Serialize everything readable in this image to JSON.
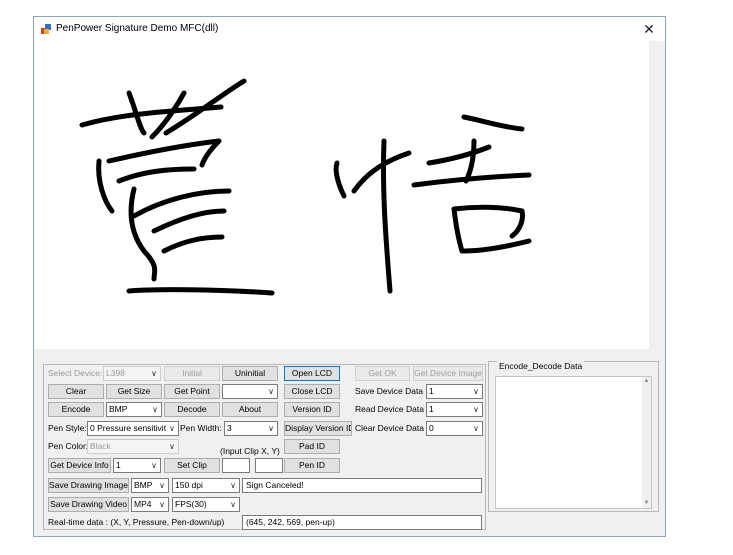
{
  "window": {
    "title": "PenPower Signature Demo MFC(dll)"
  },
  "signature": {
    "description": "handwritten signature strokes"
  },
  "controls": {
    "select_device_label": "Select Device:",
    "select_device_value": "L398",
    "initial": "Initial",
    "uninitial": "Uninitial",
    "open_lcd": "Open LCD",
    "get_ok": "Get OK",
    "get_device_image": "Get Device Image",
    "clear": "Clear",
    "get_size": "Get Size",
    "get_point": "Get Point",
    "get_point_combo": "",
    "close_lcd": "Close LCD",
    "save_device_data": "Save Device Data",
    "save_device_data_value": "1",
    "encode": "Encode",
    "encode_format": "BMP",
    "decode": "Decode",
    "about": "About",
    "version_id": "Version ID",
    "read_device_data": "Read Device Data",
    "read_device_data_value": "1",
    "pen_style_label": "Pen Style:",
    "pen_style_value": "0 Pressure sensitivit",
    "pen_width_label": "Pen Width:",
    "pen_width_value": "3",
    "display_version_id": "Display Version ID",
    "clear_device_data": "Clear Device Data",
    "clear_device_data_value": "0",
    "pen_color_label": "Pen Color:",
    "pen_color_value": "Black",
    "input_clip_label": "(Input Clip X, Y)",
    "pad_id": "Pad ID",
    "get_device_info": "Get Device Info",
    "device_info_value": "1",
    "set_clip": "Set Clip",
    "clip_x": "",
    "clip_y": "",
    "pen_id": "Pen ID",
    "save_drawing_image": "Save Drawing Image",
    "image_format": "BMP",
    "image_dpi": "150 dpi",
    "status_message": "Sign Canceled!",
    "save_drawing_video": "Save Drawing Video",
    "video_format": "MP4",
    "video_fps": "FPS(30)",
    "realtime_label": "Real-time data : (X, Y, Pressure, Pen-down/up)",
    "realtime_value": "(645, 242, 569, pen-up)"
  },
  "encode_decode": {
    "title": "Encode_Decode Data",
    "content": ""
  },
  "icons": {
    "app": "app-icon",
    "close": "close-icon",
    "dropdown": "chevron-down-icon"
  }
}
